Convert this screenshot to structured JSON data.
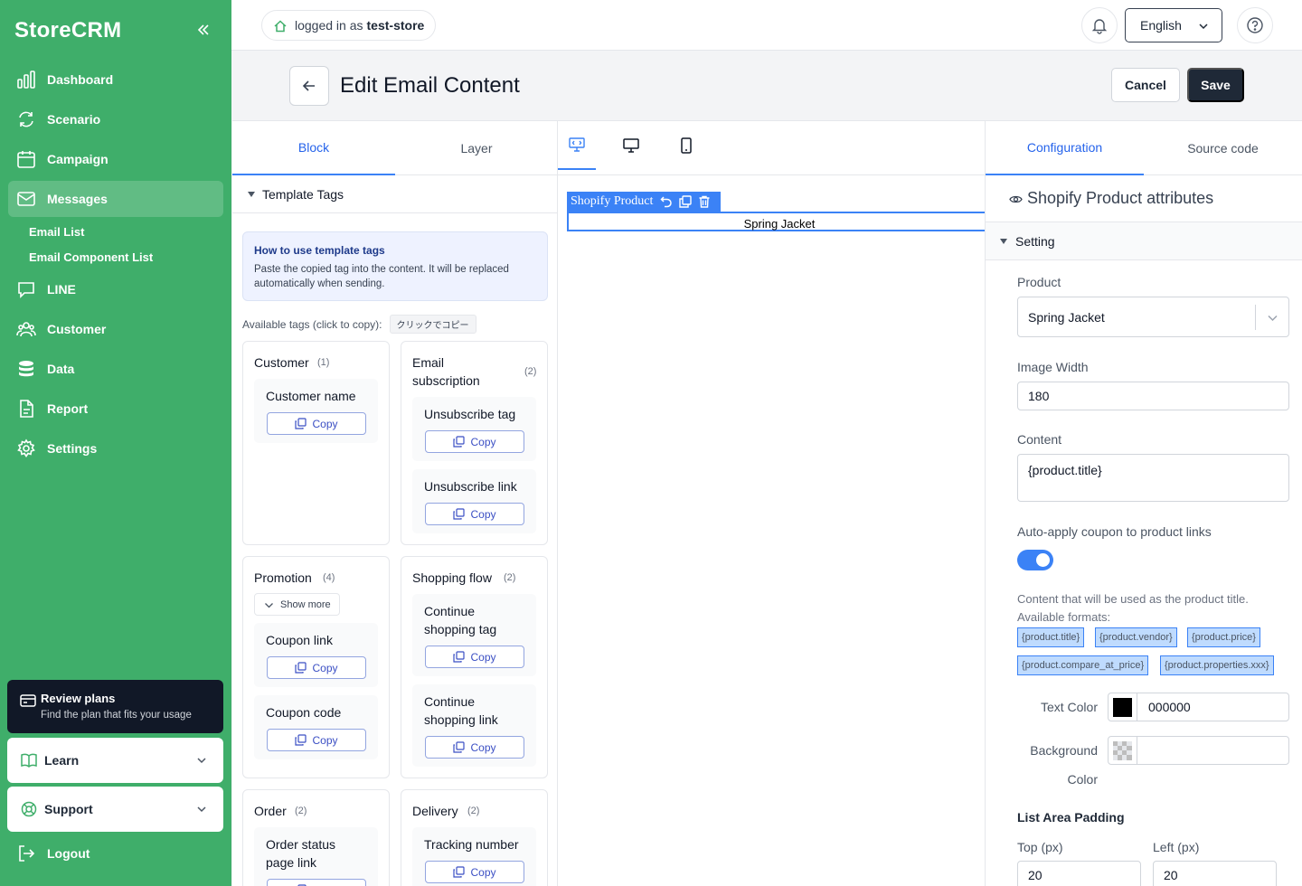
{
  "sidebar": {
    "brand": "StoreCRM",
    "nav": [
      {
        "label": "Dashboard",
        "icon": "bar-chart-icon"
      },
      {
        "label": "Scenario",
        "icon": "refresh-icon"
      },
      {
        "label": "Campaign",
        "icon": "calendar-icon"
      },
      {
        "label": "Messages",
        "icon": "mail-icon",
        "active": true
      },
      {
        "label": "LINE",
        "icon": "chat-icon"
      },
      {
        "label": "Customer",
        "icon": "users-icon"
      },
      {
        "label": "Data",
        "icon": "database-icon"
      },
      {
        "label": "Report",
        "icon": "document-icon"
      },
      {
        "label": "Settings",
        "icon": "gear-icon"
      }
    ],
    "messages_sub": [
      "Email List",
      "Email Component List"
    ],
    "review": {
      "title": "Review plans",
      "subtitle": "Find the plan that fits your usage"
    },
    "learn": "Learn",
    "support": "Support",
    "logout": "Logout"
  },
  "topbar": {
    "login_prefix": "logged in as",
    "store": "test-store",
    "language": "English"
  },
  "header": {
    "title": "Edit Email Content",
    "cancel": "Cancel",
    "save": "Save"
  },
  "left_panel": {
    "tabs": [
      "Block",
      "Layer"
    ],
    "section": "Template Tags",
    "howto_title": "How to use template tags",
    "howto_body": "Paste the copied tag into the content. It will be replaced automatically when sending.",
    "available_label": "Available tags (click to copy):",
    "available_chip": "クリックでコピー",
    "copy_label": "Copy",
    "show_more": "Show more",
    "groups": [
      {
        "title": "Customer",
        "count": "(1)",
        "items": [
          "Customer name"
        ]
      },
      {
        "title": "Email subscription",
        "count": "(2)",
        "items": [
          "Unsubscribe tag",
          "Unsubscribe link"
        ]
      },
      {
        "title": "Promotion",
        "count": "(4)",
        "items": [
          "Coupon link",
          "Coupon code"
        ]
      },
      {
        "title": "Shopping flow",
        "count": "(2)",
        "items": [
          "Continue shopping tag",
          "Continue shopping link"
        ]
      },
      {
        "title": "Order",
        "count": "(2)",
        "items": [
          "Order status page link"
        ]
      },
      {
        "title": "Delivery",
        "count": "(2)",
        "items": [
          "Tracking number"
        ]
      }
    ]
  },
  "canvas": {
    "block_name": "Shopify Product",
    "block_content": "Spring Jacket"
  },
  "right_panel": {
    "tabs": [
      "Configuration",
      "Source code"
    ],
    "attr_title": "Shopify Product attributes",
    "setting": "Setting",
    "product_label": "Product",
    "product_value": "Spring Jacket",
    "image_width_label": "Image Width",
    "image_width_value": "180",
    "content_label": "Content",
    "content_value": "{product.title}",
    "coupon_label": "Auto-apply coupon to product links",
    "coupon_enabled": true,
    "help_line1": "Content that will be used as the product title.",
    "help_line2": "Available formats:",
    "formats": [
      "{product.title}",
      "{product.vendor}",
      "{product.price}",
      "{product.compare_at_price}",
      "{product.properties.xxx}"
    ],
    "text_color_label": "Text Color",
    "text_color_value": "000000",
    "text_color_hex": "#000000",
    "bg_color_label_1": "Background",
    "bg_color_label_2": "Color",
    "bg_color_value": "",
    "padding_title": "List Area Padding",
    "top_label": "Top (px)",
    "top_value": "20",
    "left_label": "Left (px)",
    "left_value": "20"
  },
  "colors": {
    "sidebar": "#3fae6a",
    "accent": "#3b82f6",
    "dark": "#1f2937"
  }
}
